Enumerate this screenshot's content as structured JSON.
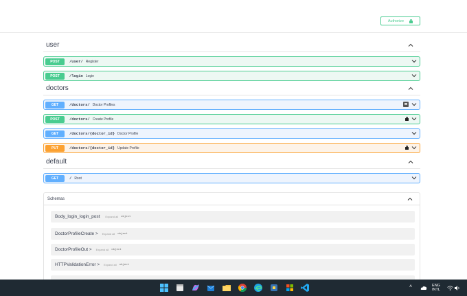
{
  "header": {
    "authorize_label": "Authorize"
  },
  "sections": [
    {
      "title": "user",
      "operations": [
        {
          "method": "POST",
          "path": "/user/",
          "summary": "Register"
        },
        {
          "method": "POST",
          "path": "/login",
          "summary": "Login"
        }
      ]
    },
    {
      "title": "doctors",
      "operations": [
        {
          "method": "GET",
          "path": "/doctors/",
          "summary": "Doctor Profiles"
        },
        {
          "method": "POST",
          "path": "/doctors/",
          "summary": "Create Profile"
        },
        {
          "method": "GET",
          "path": "/doctors/{doctor_id}",
          "summary": "Doctor Profile"
        },
        {
          "method": "PUT",
          "path": "/doctors/{doctor_id}",
          "summary": "Update Profile"
        }
      ]
    },
    {
      "title": "default",
      "operations": [
        {
          "method": "GET",
          "path": "/",
          "summary": "Root"
        }
      ]
    }
  ],
  "schemas": {
    "title": "Schemas",
    "items": [
      {
        "name": "Body_login_login_post",
        "arrow": "",
        "expand": "Expand all",
        "type": "object"
      },
      {
        "name": "DoctorProfileCreate",
        "arrow": ">",
        "expand": "Expand all",
        "type": "object"
      },
      {
        "name": "DoctorProfileOut",
        "arrow": ">",
        "expand": "Expand all",
        "type": "object"
      },
      {
        "name": "HTTPValidationError",
        "arrow": ">",
        "expand": "Expand all",
        "type": "object"
      }
    ]
  },
  "taskbar": {
    "lang_line1": "ENG",
    "lang_line2": "INTL",
    "apps": [
      "windows-start",
      "calendar-app",
      "copilot-app",
      "outlook-app",
      "file-explorer",
      "chrome-browser",
      "edge-browser",
      "python-app",
      "microsoft-store",
      "vscode"
    ]
  },
  "colors": {
    "post": "#49cc90",
    "get": "#61affe",
    "put": "#fca130",
    "taskbar": "#1f2a33"
  }
}
